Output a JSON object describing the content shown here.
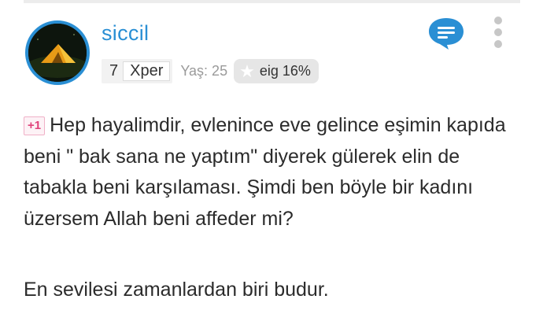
{
  "user": {
    "name": "siccil",
    "level_number": "7",
    "level_name": "Xper",
    "age_label": "Yaş: 25",
    "eig_label": "eig 16%"
  },
  "post": {
    "plus_badge": "+1",
    "paragraph1": "Hep hayalimdir, evlenince eve gelince eşimin kapıda beni \" bak sana ne yaptım\" diyerek gülerek elin de tabakla beni karşılaması. Şimdi ben böyle bir kadını üzersem Allah beni affeder mi?",
    "paragraph2": "En sevilesi zamanlardan biri budur."
  },
  "icons": {
    "chat": "chat-bubble-icon",
    "more": "more-vertical-icon",
    "star": "star-icon"
  },
  "colors": {
    "accent": "#2a8fd4",
    "plus_badge": "#e0427a"
  }
}
